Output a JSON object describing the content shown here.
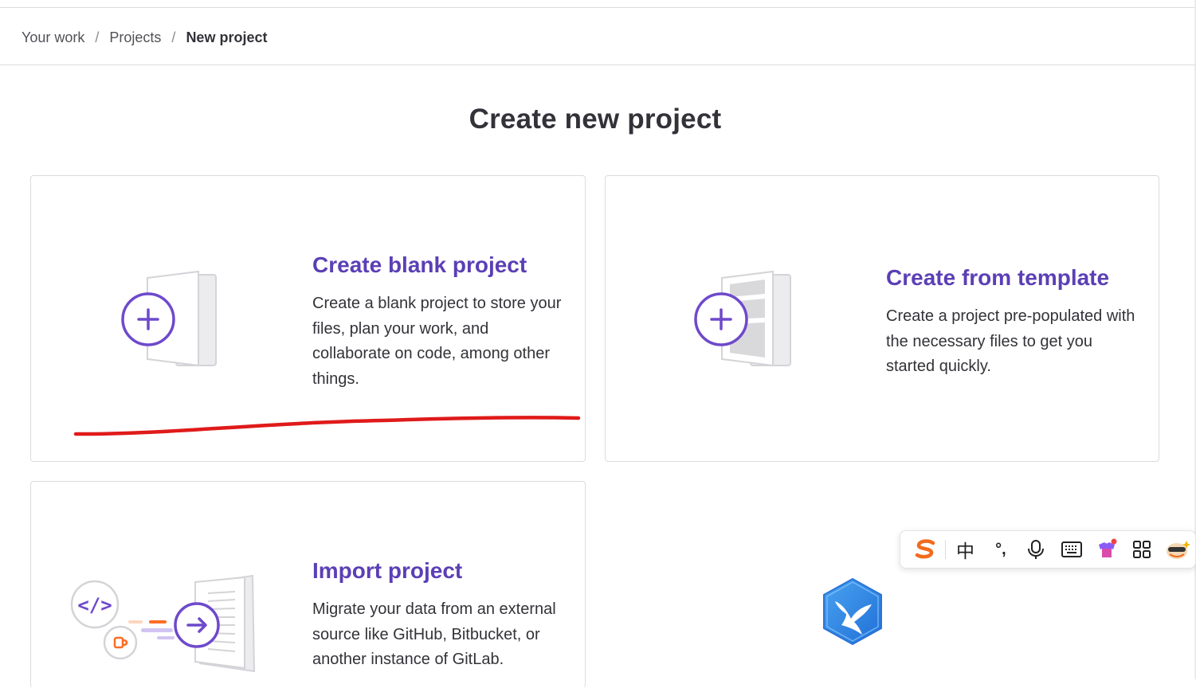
{
  "breadcrumb": {
    "items": [
      "Your work",
      "Projects"
    ],
    "current": "New project",
    "separator": "/"
  },
  "page": {
    "title": "Create new project"
  },
  "cards": {
    "blank": {
      "title": "Create blank project",
      "description": "Create a blank project to store your files, plan your work, and collaborate on code, among other things."
    },
    "template": {
      "title": "Create from template",
      "description": "Create a project pre-populated with the necessary files to get you started quickly."
    },
    "import": {
      "title": "Import project",
      "description": "Migrate your data from an external source like GitHub, Bitbucket, or another instance of GitLab."
    }
  },
  "ime_toolbar": {
    "chinese_label": "中",
    "punct_label": "°,",
    "icons": [
      "sogou-logo-icon",
      "chinese-mode-icon",
      "punctuation-icon",
      "microphone-icon",
      "keyboard-icon",
      "skin-icon",
      "grid-apps-icon",
      "mascot-icon"
    ]
  },
  "colors": {
    "accent": "#5b3fb5",
    "icon_purple": "#6e49cb",
    "annotation_red": "#e01a1a",
    "text": "#333238",
    "border": "#dcdcde"
  }
}
